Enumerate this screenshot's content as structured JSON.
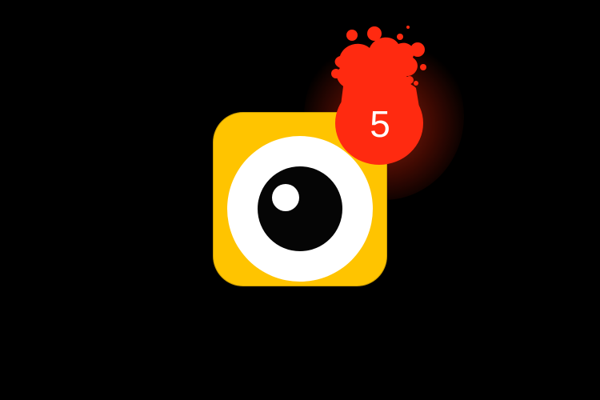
{
  "app_icon": {
    "icon": "camera-eye-icon",
    "background_color": "#FFC400",
    "eye_color": "#FFFFFF",
    "pupil_color": "#050505"
  },
  "badge": {
    "count": "5",
    "color": "#FF2A10",
    "icon": "notification-splat-icon"
  }
}
